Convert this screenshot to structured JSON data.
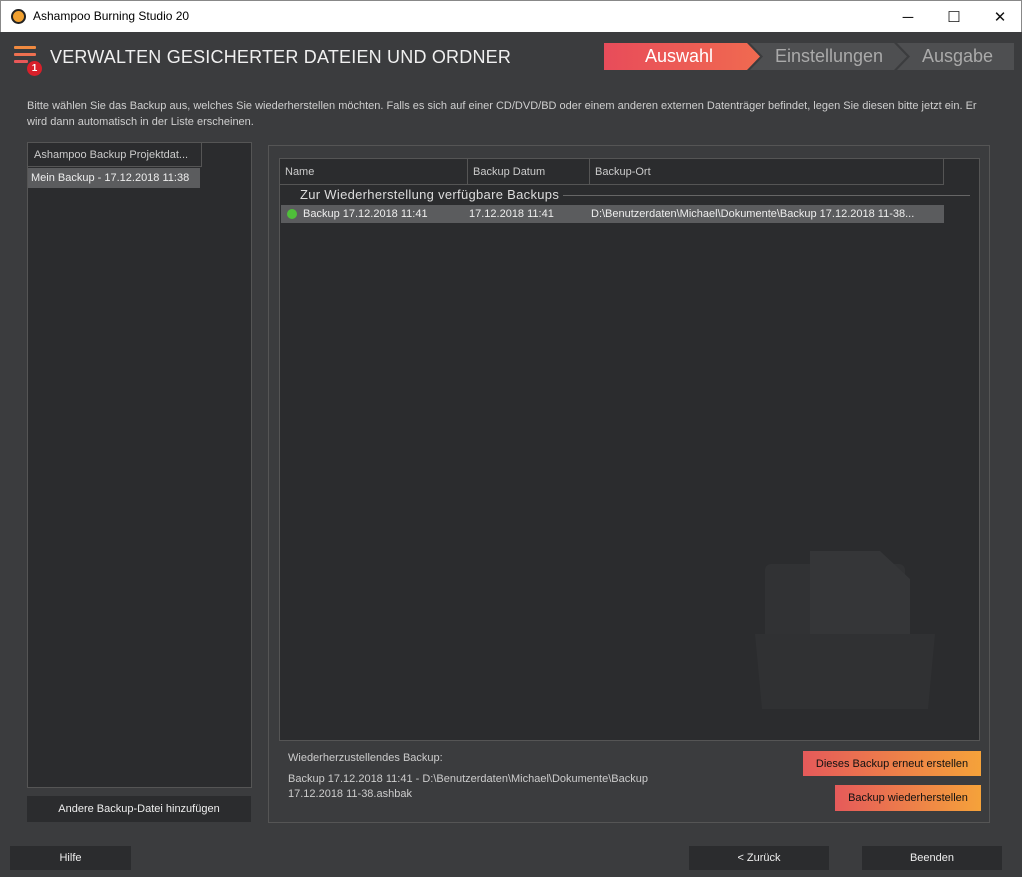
{
  "window": {
    "title": "Ashampoo Burning Studio 20",
    "minimize": "─",
    "maximize": "☐",
    "close": "✕"
  },
  "header": {
    "title": "VERWALTEN GESICHERTER DATEIEN UND ORDNER",
    "badge": "1"
  },
  "steps": [
    {
      "label": "Auswahl",
      "active": true
    },
    {
      "label": "Einstellungen",
      "active": false
    },
    {
      "label": "Ausgabe",
      "active": false
    }
  ],
  "intro": "Bitte wählen Sie das Backup aus, welches Sie wiederherstellen möchten. Falls es sich auf einer CD/DVD/BD oder einem anderen externen Datenträger befindet, legen Sie diesen bitte jetzt ein. Er wird dann automatisch in der Liste erscheinen.",
  "left": {
    "header": "Ashampoo Backup Projektdat...",
    "items": [
      "Mein Backup - 17.12.2018 11:38"
    ],
    "add_button": "Andere Backup-Datei hinzufügen"
  },
  "list": {
    "columns": [
      "Name",
      "Backup Datum",
      "Backup-Ort"
    ],
    "group": "Zur Wiederherstellung verfügbare Backups",
    "rows": [
      {
        "name": "Backup 17.12.2018 11:41",
        "date": "17.12.2018 11:41",
        "location": "D:\\Benutzerdaten\\Michael\\Dokumente\\Backup 17.12.2018 11-38...",
        "status": "ok"
      }
    ]
  },
  "detail": {
    "label": "Wiederherzustellendes Backup:",
    "value_line1": "Backup 17.12.2018 11:41 - D:\\Benutzerdaten\\Michael\\Dokumente\\Backup",
    "value_line2": "17.12.2018 11-38.ashbak"
  },
  "actions": {
    "recreate": "Dieses Backup erneut erstellen",
    "restore": "Backup wiederherstellen"
  },
  "footer": {
    "help": "Hilfe",
    "back": "< Zurück",
    "finish": "Beenden"
  },
  "colors": {
    "accent_start": "#e55a5a",
    "accent_end": "#f5a23a",
    "status_ok": "#4fbf3a"
  }
}
